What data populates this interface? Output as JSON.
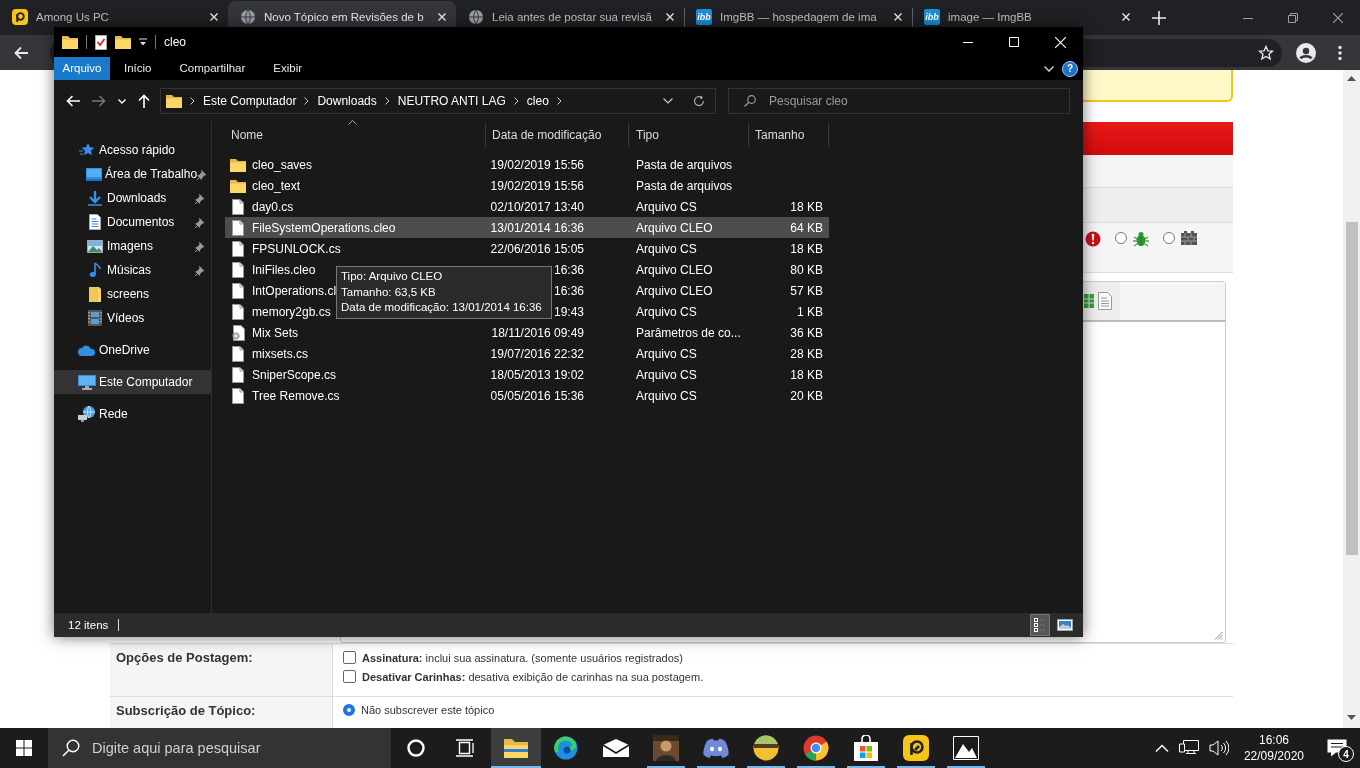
{
  "browser": {
    "tabs": [
      {
        "title": "Among Us PC",
        "kind": "app",
        "selected": false
      },
      {
        "title": "Novo Tópico em Revisões de b",
        "kind": "globe",
        "selected": true
      },
      {
        "title": "Leia antes de postar sua revisã",
        "kind": "globe",
        "selected": false
      },
      {
        "title": "ImgBB — hospedagem de ima",
        "kind": "logo",
        "logo_text": "ibb",
        "selected": false
      },
      {
        "title": "image — ImgBB",
        "kind": "logo",
        "logo_text": "ibb",
        "selected": false
      }
    ]
  },
  "explorer": {
    "title": "cleo",
    "ribbon_tabs": [
      {
        "label": "Arquivo",
        "selected": true
      },
      {
        "label": "Início",
        "selected": false
      },
      {
        "label": "Compartilhar",
        "selected": false
      },
      {
        "label": "Exibir",
        "selected": false
      }
    ],
    "help": "?",
    "breadcrumb": [
      "Este Computador",
      "Downloads",
      "NEUTRO ANTI LAG",
      "cleo"
    ],
    "search": {
      "placeholder": "Pesquisar cleo"
    },
    "nav": [
      {
        "label": "Acesso rápido",
        "kind": "star",
        "selected": false,
        "children": [
          {
            "label": "Área de Trabalho",
            "kind": "desktop",
            "pinned": true,
            "selected": false
          },
          {
            "label": "Downloads",
            "kind": "download",
            "pinned": true,
            "selected": false
          },
          {
            "label": "Documentos",
            "kind": "document",
            "pinned": true,
            "selected": false
          },
          {
            "label": "Imagens",
            "kind": "image",
            "pinned": true,
            "selected": false
          },
          {
            "label": "Músicas",
            "kind": "music",
            "pinned": true,
            "selected": false
          },
          {
            "label": "screens",
            "kind": "folder",
            "pinned": false,
            "selected": false
          },
          {
            "label": "Vídeos",
            "kind": "video",
            "pinned": false,
            "selected": false
          }
        ]
      },
      {
        "label": "OneDrive",
        "kind": "cloud",
        "selected": false
      },
      {
        "label": "Este Computador",
        "kind": "computer",
        "selected": true
      },
      {
        "label": "Rede",
        "kind": "network",
        "selected": false
      }
    ],
    "columns": [
      "Nome",
      "Data de modificação",
      "Tipo",
      "Tamanho"
    ],
    "files": [
      {
        "name": "cleo_saves",
        "kind": "folder",
        "date": "19/02/2019 15:56",
        "type": "Pasta de arquivos",
        "highlighted": false
      },
      {
        "name": "cleo_text",
        "kind": "folder",
        "date": "19/02/2019 15:56",
        "type": "Pasta de arquivos",
        "highlighted": false
      },
      {
        "name": "day0.cs",
        "kind": "file",
        "date": "02/10/2017 13:40",
        "type": "Arquivo CS",
        "size": "18 KB",
        "highlighted": false
      },
      {
        "name": "FileSystemOperations.cleo",
        "kind": "file",
        "date": "13/01/2014 16:36",
        "type": "Arquivo CLEO",
        "size": "64 KB",
        "highlighted": true
      },
      {
        "name": "FPSUNLOCK.cs",
        "kind": "file",
        "date": "22/06/2016 15:05",
        "type": "Arquivo CS",
        "size": "18 KB",
        "highlighted": false
      },
      {
        "name": "IniFiles.cleo",
        "kind": "file",
        "date": "16:36",
        "type": "Arquivo CLEO",
        "size": "80 KB",
        "highlighted": false
      },
      {
        "name": "IntOperations.cl",
        "kind": "file",
        "date": "16:36",
        "type": "Arquivo CLEO",
        "size": "57 KB",
        "highlighted": false
      },
      {
        "name": "memory2gb.cs",
        "kind": "file",
        "date": "19:43",
        "type": "Arquivo CS",
        "size": "1 KB",
        "highlighted": false
      },
      {
        "name": "Mix Sets",
        "kind": "config",
        "date": "18/11/2016 09:49",
        "type": "Parâmetros de co...",
        "size": "36 KB",
        "highlighted": false
      },
      {
        "name": "mixsets.cs",
        "kind": "file",
        "date": "19/07/2016 22:32",
        "type": "Arquivo CS",
        "size": "28 KB",
        "highlighted": false
      },
      {
        "name": "SniperScope.cs",
        "kind": "file",
        "date": "18/05/2013 19:02",
        "type": "Arquivo CS",
        "size": "18 KB",
        "highlighted": false
      },
      {
        "name": "Tree Remove.cs",
        "kind": "file",
        "date": "05/05/2016 15:36",
        "type": "Arquivo CS",
        "size": "20 KB",
        "highlighted": false
      }
    ],
    "tooltip": [
      "Tipo: Arquivo CLEO",
      "Tamanho: 63,5 KB",
      "Data de modificação: 13/01/2014 16:36"
    ],
    "status": "12 itens",
    "views": [
      {
        "kind": "details",
        "selected": true
      },
      {
        "kind": "tiles",
        "selected": false
      }
    ]
  },
  "page": {
    "post_icons": [
      {
        "kind": "alert"
      },
      {
        "kind": "bug",
        "selected": false
      },
      {
        "kind": "wall",
        "selected": false
      }
    ],
    "options": [
      {
        "label": "Opções de Postagem:",
        "controls": [
          {
            "kind": "checkbox",
            "checked": false,
            "text": "**Assinatura:** inclui sua assinatura. (somente usuários registrados)"
          },
          {
            "kind": "checkbox",
            "checked": false,
            "text": "**Desativar Carinhas:** desativa exibição de carinhas na sua postagem."
          }
        ]
      },
      {
        "label": "Subscrição de Tópico:",
        "controls": [
          {
            "kind": "radio",
            "selected": true,
            "text": "Não subscrever este tópico"
          }
        ]
      }
    ]
  },
  "taskbar": {
    "search": {
      "placeholder": "Digite aqui para pesquisar"
    },
    "apps": [
      {
        "kind": "cortana",
        "running": false,
        "active": false
      },
      {
        "kind": "taskview",
        "running": false,
        "active": false
      },
      {
        "kind": "explorer",
        "running": true,
        "active": true
      },
      {
        "kind": "edge",
        "running": false,
        "active": false
      },
      {
        "kind": "mail",
        "running": false,
        "active": false
      },
      {
        "kind": "game",
        "running": true,
        "active": false
      },
      {
        "kind": "discord",
        "running": true,
        "active": false
      },
      {
        "kind": "bowl",
        "running": true,
        "active": false
      },
      {
        "kind": "chrome",
        "running": true,
        "active": false
      },
      {
        "kind": "store",
        "running": true,
        "active": false
      },
      {
        "kind": "ldplayer",
        "running": true,
        "active": false
      },
      {
        "kind": "photos",
        "running": true,
        "active": false
      }
    ],
    "clock": {
      "time": "16:06",
      "date": "22/09/2020"
    },
    "notifications": "4"
  }
}
